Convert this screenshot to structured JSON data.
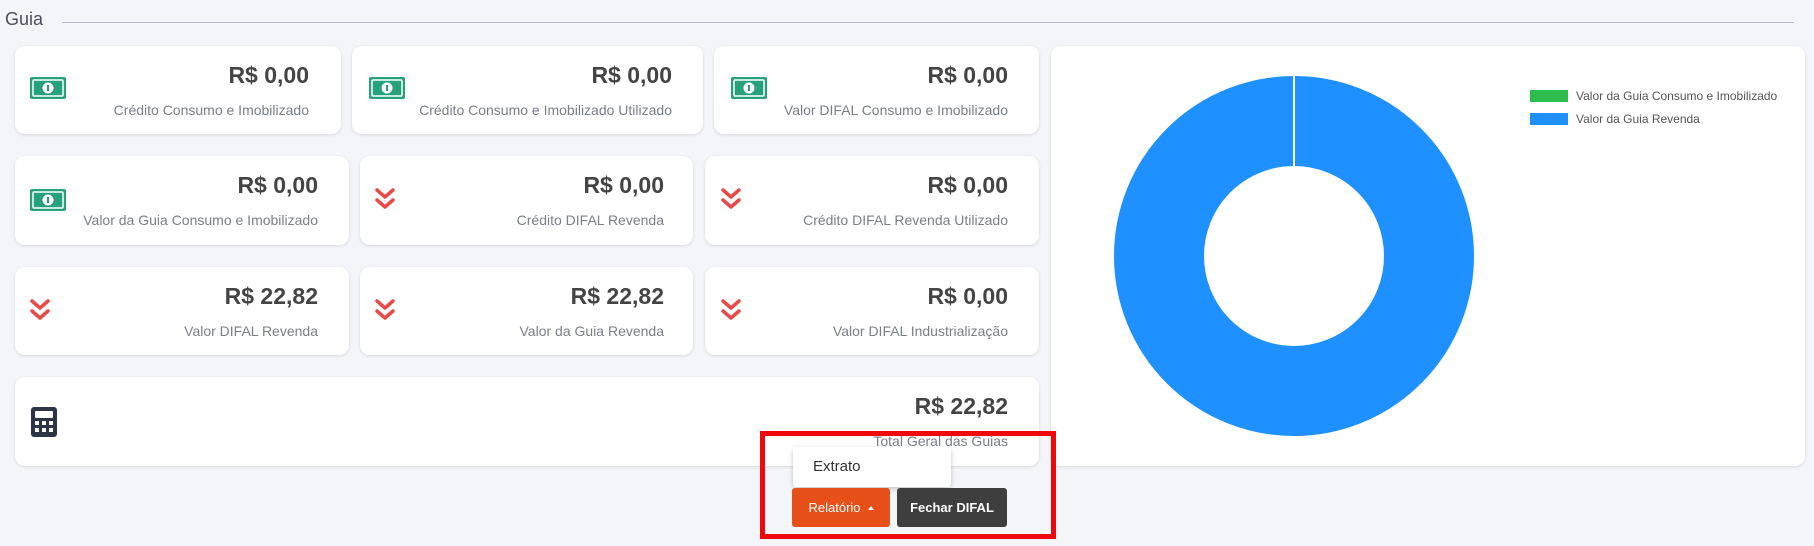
{
  "section": {
    "title": "Guia"
  },
  "cards": [
    {
      "value": "R$ 0,00",
      "label": "Crédito Consumo e Imobilizado",
      "icon": "money-icon"
    },
    {
      "value": "R$ 0,00",
      "label": "Crédito Consumo e Imobilizado Utilizado",
      "icon": "money-icon"
    },
    {
      "value": "R$ 0,00",
      "label": "Valor DIFAL Consumo e Imobilizado",
      "icon": "money-icon"
    },
    {
      "value": "R$ 0,00",
      "label": "Valor da Guia Consumo e Imobilizado",
      "icon": "money-icon"
    },
    {
      "value": "R$ 0,00",
      "label": "Crédito DIFAL Revenda",
      "icon": "double-chevron-down-icon"
    },
    {
      "value": "R$ 0,00",
      "label": "Crédito DIFAL Revenda Utilizado",
      "icon": "double-chevron-down-icon"
    },
    {
      "value": "R$ 22,82",
      "label": "Valor DIFAL Revenda",
      "icon": "double-chevron-down-icon"
    },
    {
      "value": "R$ 22,82",
      "label": "Valor da Guia Revenda",
      "icon": "double-chevron-down-icon"
    },
    {
      "value": "R$ 0,00",
      "label": "Valor DIFAL Industrialização",
      "icon": "double-chevron-down-icon"
    }
  ],
  "total": {
    "value": "R$ 22,82",
    "label": "Total Geral das Guias",
    "icon": "calculator-icon"
  },
  "colors": {
    "money": "#26a17b",
    "chevron": "#e84a4a",
    "orange": "#e8501a",
    "dark": "#3e3e3e",
    "highlight": "#ee0a0a"
  },
  "chart_data": {
    "type": "pie",
    "subtype": "donut",
    "categories": [
      "Valor da Guia Consumo e Imobilizado",
      "Valor da Guia Revenda"
    ],
    "values": [
      0,
      22.82
    ],
    "colors": [
      "#2dbd4e",
      "#1e90ff"
    ],
    "legend": "top-right"
  },
  "actions": {
    "dropdown_item": "Extrato",
    "relatorio_label": "Relatório",
    "fechar_label": "Fechar DIFAL"
  }
}
